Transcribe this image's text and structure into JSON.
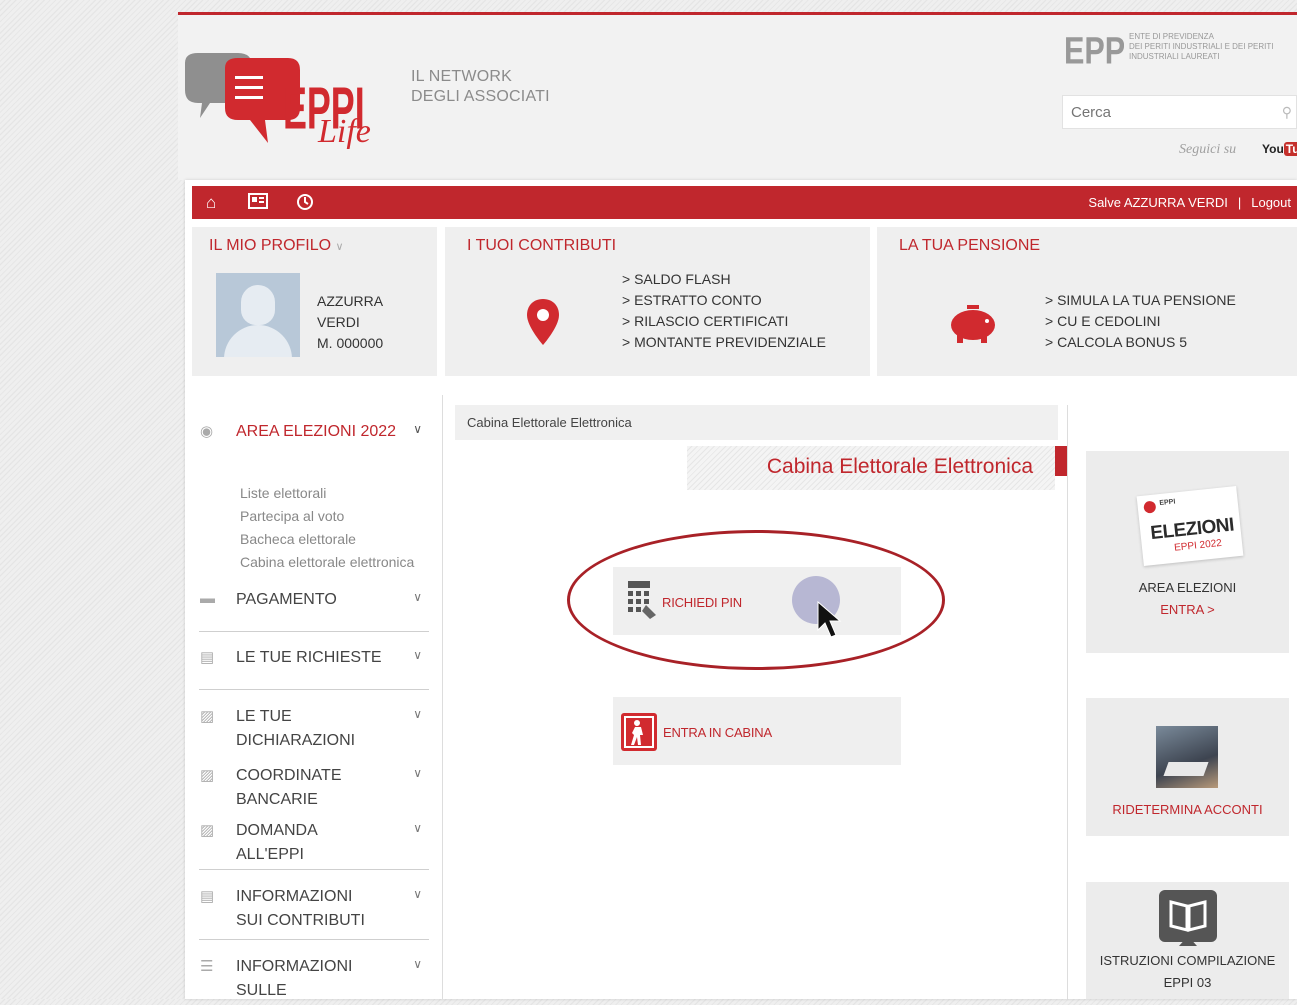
{
  "header": {
    "logo_text": "EPPI Life",
    "tagline_line1": "IL NETWORK",
    "tagline_line2": "DEGLI ASSOCIATI",
    "eppi_logo": "EPPI",
    "eppi_line1": "ENTE DI PREVIDENZA",
    "eppi_line2": "DEI PERITI INDUSTRIALI E DEI PERITI",
    "eppi_line3": "INDUSTRIALI LAUREATI",
    "search_placeholder": "Cerca",
    "seguici": "Seguici su",
    "youtube_you": "You",
    "youtube_tube": "Tub"
  },
  "navbar": {
    "icons": [
      "home-icon",
      "id-card-icon",
      "clock-icon"
    ],
    "greeting": "Salve AZZURRA VERDI",
    "separator": "|",
    "logout": "Logout"
  },
  "profile": {
    "title": "IL MIO PROFILO",
    "first_name": "AZZURRA",
    "last_name": "VERDI",
    "member_id": "M. 000000"
  },
  "contributions": {
    "title": "I TUOI CONTRIBUTI",
    "links": [
      "SALDO FLASH",
      "ESTRATTO CONTO",
      "RILASCIO CERTIFICATI",
      "MONTANTE PREVIDENZIALE"
    ]
  },
  "pension": {
    "title": "LA TUA PENSIONE",
    "links": [
      "SIMULA LA TUA PENSIONE",
      "CU E CEDOLINI",
      "CALCOLA BONUS 5"
    ]
  },
  "sidebar": {
    "area": "AREA ELEZIONI 2022",
    "sublinks": [
      "Liste elettorali",
      "Partecipa al voto",
      "Bacheca elettorale",
      "Cabina elettorale elettronica"
    ],
    "items": [
      {
        "line1": "PAGAMENTO",
        "line2": ""
      },
      {
        "line1": "LE TUE RICHIESTE",
        "line2": ""
      },
      {
        "line1": "LE TUE",
        "line2": "DICHIARAZIONI"
      },
      {
        "line1": "COORDINATE",
        "line2": "BANCARIE"
      },
      {
        "line1": "DOMANDA",
        "line2": "ALL'EPPI"
      },
      {
        "line1": "INFORMAZIONI",
        "line2": "SUI CONTRIBUTI"
      },
      {
        "line1": "INFORMAZIONI",
        "line2": "SULLE"
      }
    ]
  },
  "main": {
    "breadcrumb": "Cabina Elettorale Elettronica",
    "title": "Cabina Elettorale Elettronica",
    "pin_button": "RICHIEDI PIN",
    "enter_button": "ENTRA IN CABINA"
  },
  "right": {
    "elezioni_badge_top": "EPPI",
    "elezioni_badge_main": "ELEZIONI",
    "elezioni_badge_year": "EPPI 2022",
    "area_label": "AREA ELEZIONI",
    "area_link": "ENTRA >",
    "acconti": "RIDETERMINA ACCONTI",
    "istruzioni_line1": "ISTRUZIONI COMPILAZIONE",
    "istruzioni_line2": "EPPI 03"
  }
}
